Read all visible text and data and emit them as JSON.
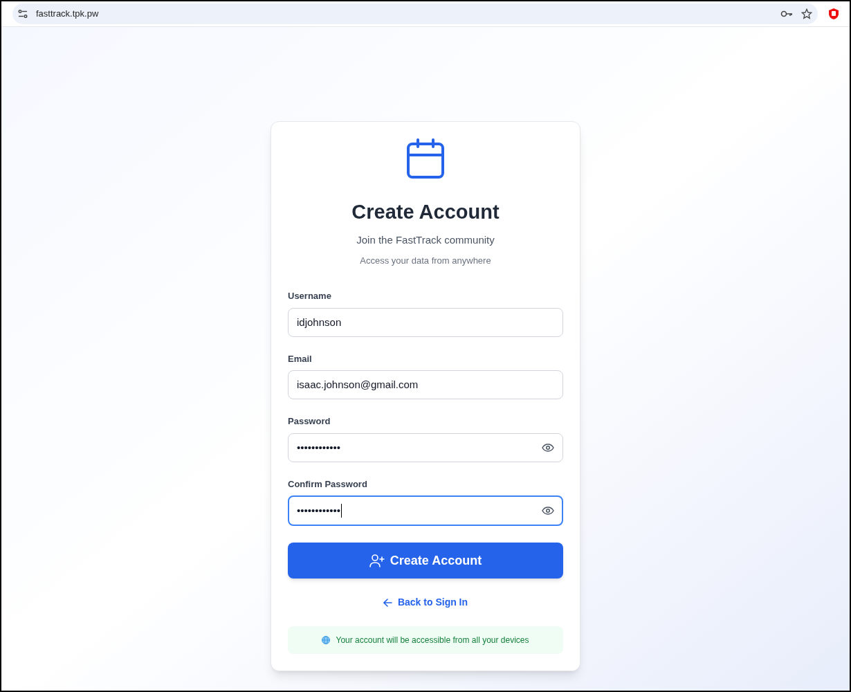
{
  "browser": {
    "url": "fasttrack.tpk.pw"
  },
  "card": {
    "title": "Create Account",
    "subtitle": "Join the FastTrack community",
    "tagline": "Access your data from anywhere",
    "fields": [
      {
        "kind": "text",
        "label": "Username",
        "value": "idjohnson",
        "focused": false
      },
      {
        "kind": "text",
        "label": "Email",
        "value": "isaac.johnson@gmail.com",
        "focused": false
      },
      {
        "kind": "password",
        "label": "Password",
        "value": "••••••••••••",
        "focused": false
      },
      {
        "kind": "password",
        "label": "Confirm Password",
        "value": "••••••••••••",
        "focused": true
      }
    ],
    "submit": "Create Account",
    "back_link": "Back to Sign In",
    "note": "Your account will be accessible from all your devices"
  }
}
